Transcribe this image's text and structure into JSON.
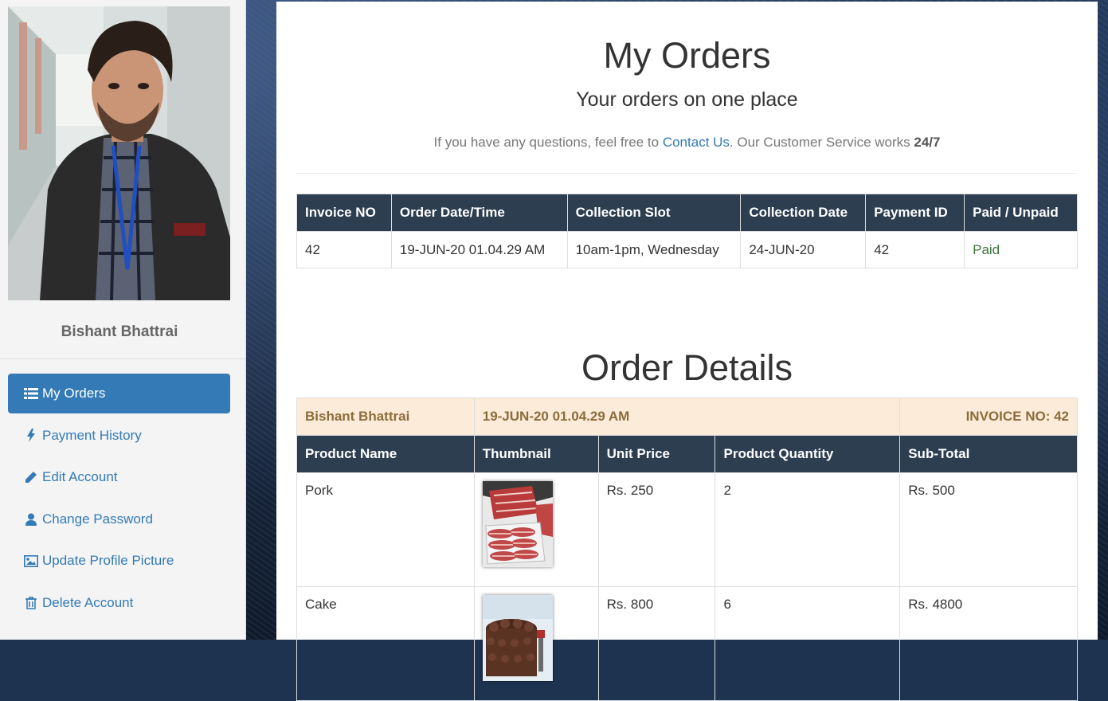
{
  "user": {
    "name": "Bishant Bhattrai"
  },
  "nav": {
    "items": [
      {
        "label": "My Orders",
        "icon": "list-icon",
        "active": true
      },
      {
        "label": "Payment History",
        "icon": "bolt-icon"
      },
      {
        "label": "Edit Account",
        "icon": "pencil-icon"
      },
      {
        "label": "Change Password",
        "icon": "user-icon"
      },
      {
        "label": "Update Profile Picture",
        "icon": "image-icon"
      },
      {
        "label": "Delete Account",
        "icon": "trash-icon"
      }
    ]
  },
  "header": {
    "title": "My Orders",
    "subtitle": "Your orders on one place",
    "help_prefix": "If you have any questions, feel free to ",
    "help_link": "Contact Us",
    "help_mid": ". Our Customer Service works ",
    "help_bold": "24/7"
  },
  "orders": {
    "columns": [
      "Invoice NO",
      "Order Date/Time",
      "Collection Slot",
      "Collection Date",
      "Payment ID",
      "Paid / Unpaid"
    ],
    "rows": [
      [
        "42",
        "19-JUN-20 01.04.29 AM",
        "10am-1pm, Wednesday",
        "24-JUN-20",
        "42",
        "Paid"
      ]
    ]
  },
  "details": {
    "title": "Order Details",
    "customer": "Bishant Bhattrai",
    "datetime": "19-JUN-20 01.04.29 AM",
    "invoice_label": "INVOICE NO: 42",
    "columns": [
      "Product Name",
      "Thumbnail",
      "Unit Price",
      "Product Quantity",
      "Sub-Total"
    ],
    "items": [
      {
        "name": "Pork",
        "thumbnail": "pork-thumbnail",
        "unit_price": "Rs. 250",
        "quantity": "2",
        "subtotal": "Rs. 500"
      },
      {
        "name": "Cake",
        "thumbnail": "cake-thumbnail",
        "unit_price": "Rs. 800",
        "quantity": "6",
        "subtotal": "Rs. 4800"
      }
    ]
  },
  "colors": {
    "primary": "#337ab7",
    "table_header": "#2c3e50",
    "info_row_bg": "#fcebd9",
    "info_row_text": "#8a6d3b",
    "paid": "#3c763d"
  }
}
